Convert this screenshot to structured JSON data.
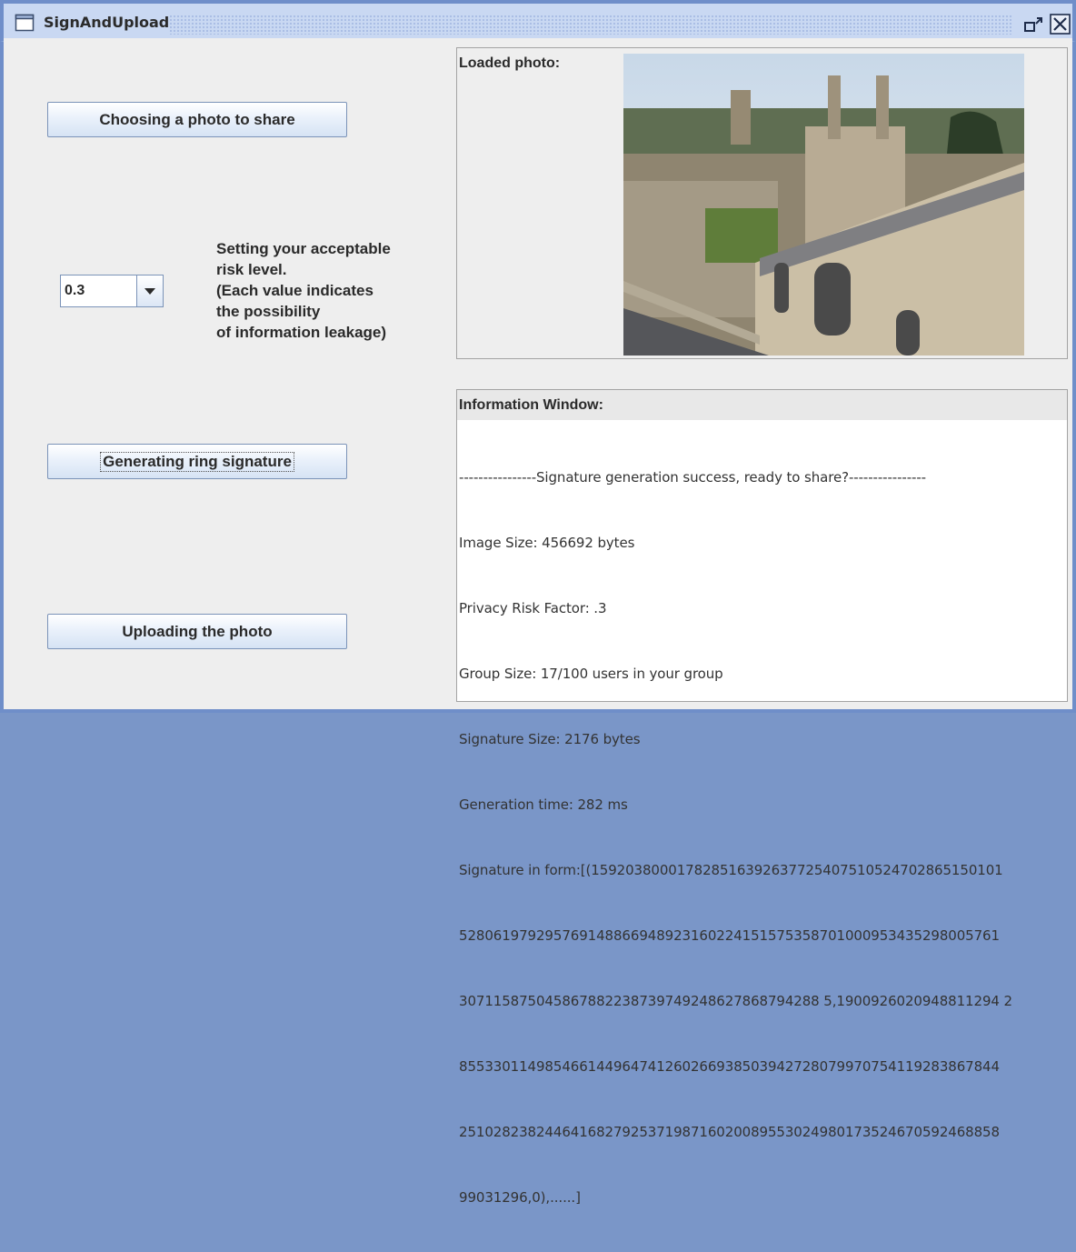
{
  "window": {
    "title": "SignAndUpload"
  },
  "buttons": {
    "choose": "Choosing a photo to share",
    "generate": "Generating ring signature",
    "upload": "Uploading the photo"
  },
  "risk": {
    "selected": "0.3",
    "lines": [
      "Setting your acceptable",
      "risk level.",
      "(Each value indicates",
      "the possibility",
      "of information leakage)"
    ]
  },
  "photo_panel": {
    "label": "Loaded photo:"
  },
  "info_panel": {
    "label": "Information Window:",
    "lines": [
      "----------------Signature generation success, ready to share?----------------",
      "Image Size: 456692 bytes",
      "Privacy Risk Factor: .3",
      "Group Size: 17/100 users in your group",
      "Signature Size: 2176 bytes",
      "Generation time: 282 ms",
      "Signature in form:[(159203800017828516392637725407510524702865150101",
      "528061979295769148866948923160224151575358701000953435298005761",
      "307115875045867882238739749248627868794288 5,1900926020948811294 2",
      "855330114985466144964741260266938503942728079970754119283867844",
      "251028238244641682792537198716020089553024980173524670592468858",
      "99031296,0),......]"
    ]
  },
  "colors": {
    "frame": "#6f8ec9",
    "titlebar": "#c9d8f2",
    "button_border": "#7b93b8"
  },
  "icons": {
    "app": "window-icon",
    "restore": "restore-icon",
    "close": "close-icon",
    "dropdown": "chevron-down-icon"
  }
}
